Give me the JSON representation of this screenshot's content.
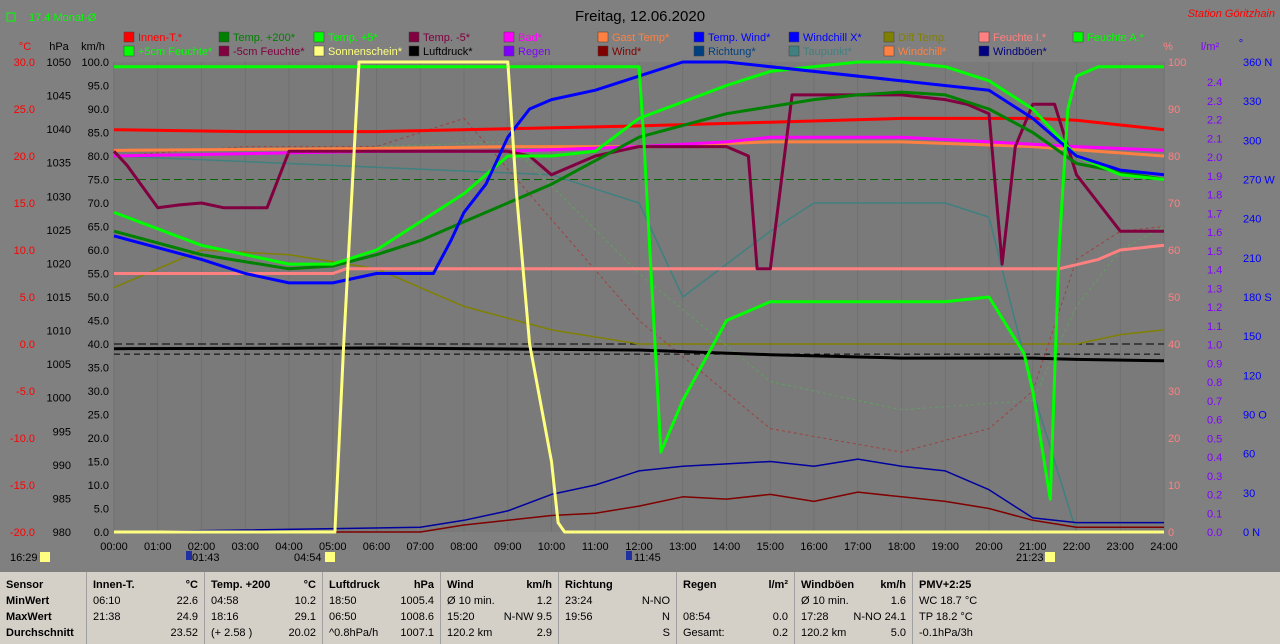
{
  "header": {
    "title": "Freitag, 12.06.2020",
    "station": "Station Göritzhain",
    "monthly": "17.4 Monat-Ø"
  },
  "legend_row1": [
    "Innen-T.*",
    "Temp. +200*",
    "Temp. +5*",
    "Temp. -5*",
    "Bad*",
    "Gast Temp*",
    "Temp. Wind*",
    "Windchill X*",
    "Diff Temp.",
    "Feuchte I.*",
    "Feuchte A.*"
  ],
  "legend_row2": [
    "+5cm Feuchte*",
    "-5cm Feuchte*",
    "Sonnenschein*",
    "Luftdruck*",
    "Regen",
    "Wind*",
    "Richtung*",
    "Taupunkt*",
    "Windchill*",
    "Windböen*"
  ],
  "axes": {
    "temp_unit": "°C",
    "pressure_unit": "hPa",
    "speed_unit": "km/h",
    "humidity_unit": "%",
    "rain_unit": "l/m²",
    "direction_unit": "°",
    "temp_ticks": [
      "30.0",
      "25.0",
      "20.0",
      "15.0",
      "10.0",
      "5.0",
      "0.0",
      "-5.0",
      "-10.0",
      "-15.0",
      "-20.0"
    ],
    "pressure_ticks": [
      "1050",
      "1045",
      "1040",
      "1035",
      "1030",
      "1025",
      "1020",
      "1015",
      "1010",
      "1005",
      "1000",
      "995",
      "990",
      "985",
      "980"
    ],
    "speed_ticks": [
      "100.0",
      "95.0",
      "90.0",
      "85.0",
      "80.0",
      "75.0",
      "70.0",
      "65.0",
      "60.0",
      "55.0",
      "50.0",
      "45.0",
      "40.0",
      "35.0",
      "30.0",
      "25.0",
      "20.0",
      "15.0",
      "10.0",
      "5.0",
      "0.0"
    ],
    "humidity_ticks": [
      "100",
      "90",
      "80",
      "70",
      "60",
      "50",
      "40",
      "30",
      "20",
      "10",
      "0"
    ],
    "rain_ticks": [
      "2.4",
      "2.3",
      "2.2",
      "2.1",
      "2.0",
      "1.9",
      "1.8",
      "1.7",
      "1.6",
      "1.5",
      "1.4",
      "1.3",
      "1.2",
      "1.1",
      "1.0",
      "0.9",
      "0.8",
      "0.7",
      "0.6",
      "0.5",
      "0.4",
      "0.3",
      "0.2",
      "0.1",
      "0.0"
    ],
    "direction_ticks": [
      "360 N",
      "330",
      "300",
      "270 W",
      "240",
      "210",
      "180 S",
      "150",
      "120",
      "90 O",
      "60",
      "30",
      "0 N"
    ],
    "time_ticks": [
      "00:00",
      "01:00",
      "02:00",
      "03:00",
      "04:00",
      "05:00",
      "06:00",
      "07:00",
      "08:00",
      "09:00",
      "10:00",
      "11:00",
      "12:00",
      "13:00",
      "14:00",
      "15:00",
      "16:00",
      "17:00",
      "18:00",
      "19:00",
      "20:00",
      "21:00",
      "22:00",
      "23:00",
      "24:00"
    ],
    "markers": [
      "16:29",
      "01:43",
      "04:54",
      "11:45",
      "21:23"
    ]
  },
  "chart_data": {
    "type": "line",
    "title": "Freitag, 12.06.2020",
    "x_unit": "hour",
    "xlim": [
      0,
      24
    ],
    "y_left": {
      "unit": "°C",
      "ylim": [
        -20,
        30
      ]
    },
    "y_right": {
      "unit": "%",
      "ylim": [
        0,
        100
      ]
    },
    "series": [
      {
        "name": "Innen-T.*",
        "axis": "temp",
        "color": "#ff0000",
        "x": [
          0,
          3,
          6,
          9,
          12,
          15,
          18,
          21,
          22,
          24
        ],
        "y": [
          22.8,
          22.6,
          22.6,
          22.9,
          23.2,
          23.6,
          24.0,
          24.0,
          23.8,
          22.8
        ]
      },
      {
        "name": "Temp. +200*",
        "axis": "temp",
        "color": "#008000",
        "x": [
          0,
          2,
          4,
          5,
          6,
          7,
          8,
          9,
          10,
          11,
          12,
          14,
          16,
          17,
          18,
          19,
          20,
          21,
          22,
          23,
          24
        ],
        "y": [
          12.0,
          9.5,
          8.0,
          8.3,
          9.5,
          11.0,
          13.0,
          15.0,
          17.0,
          19.5,
          22.0,
          24.5,
          26.0,
          26.5,
          26.8,
          26.5,
          25.0,
          22.5,
          19.2,
          18.3,
          17.5
        ]
      },
      {
        "name": "Temp. +5*",
        "axis": "temp",
        "color": "#00ff00",
        "x": [
          0,
          2,
          4,
          5,
          6,
          7,
          8,
          9,
          10,
          11,
          12,
          14,
          15,
          17,
          18,
          19,
          20,
          21,
          22,
          23,
          24
        ],
        "y": [
          14.0,
          10.5,
          8.5,
          8.5,
          10.0,
          13.0,
          16.0,
          20.0,
          20.0,
          20.5,
          24.0,
          27.5,
          29.0,
          30.0,
          30.0,
          29.5,
          28.0,
          25.0,
          20.0,
          18.0,
          17.5
        ]
      },
      {
        "name": "Temp. Wind*",
        "axis": "temp",
        "color": "#0000ff",
        "x": [
          0,
          2,
          3,
          4,
          5,
          6,
          7,
          7.3,
          7.7,
          8,
          8.5,
          9,
          9.5,
          10,
          11,
          12,
          13,
          14,
          20,
          21,
          22,
          23,
          24
        ],
        "y": [
          11.5,
          9.0,
          7.5,
          6.5,
          6.5,
          7.5,
          7.5,
          7.5,
          11.0,
          14.0,
          17.0,
          22.0,
          25.0,
          26.0,
          27.0,
          28.5,
          30.0,
          31.0,
          27.0,
          24.0,
          20.0,
          18.5,
          18.0
        ]
      },
      {
        "name": "Temp. -5*",
        "axis": "temp",
        "color": "#800040",
        "x": [
          0,
          0.3,
          1,
          1.5,
          2,
          2.5,
          3,
          3.5,
          4,
          5,
          6,
          7,
          8,
          9,
          9.5,
          10,
          11,
          12,
          14,
          14.5,
          14.7,
          15,
          15.5,
          18,
          19,
          19.5,
          20,
          20.3,
          20.6,
          21,
          21.5,
          22,
          22.5,
          23,
          24
        ],
        "y": [
          20.5,
          19.0,
          14.5,
          14.8,
          15.0,
          14.5,
          14.5,
          14.5,
          20.5,
          20.5,
          20.5,
          20.5,
          20.5,
          20.5,
          20.0,
          18.0,
          20.0,
          21.0,
          21.0,
          20.0,
          8.0,
          8.0,
          26.5,
          26.5,
          26.0,
          25.5,
          24.5,
          8.5,
          21.0,
          25.5,
          25.5,
          18.0,
          15.0,
          12.0,
          12.0
        ]
      },
      {
        "name": "Bad*",
        "axis": "temp",
        "color": "#ff00ff",
        "x": [
          0,
          6,
          9,
          12,
          14,
          15,
          16,
          18,
          20,
          22,
          24
        ],
        "y": [
          20.0,
          20.5,
          20.5,
          21.0,
          21.5,
          22.0,
          22.0,
          22.0,
          21.5,
          21.0,
          20.6
        ]
      },
      {
        "name": "Gast Temp*",
        "axis": "temp",
        "color": "#ff8040",
        "x": [
          0,
          6,
          9,
          12,
          15,
          18,
          21,
          24
        ],
        "y": [
          20.6,
          20.8,
          21.0,
          21.0,
          21.5,
          21.5,
          21.0,
          20.0
        ]
      },
      {
        "name": "Feuchte I.*",
        "axis": "hum",
        "color": "#ff8080",
        "x": [
          0,
          5,
          5.3,
          12,
          16,
          17,
          18,
          19,
          20,
          21,
          21.6,
          22.5,
          23,
          24
        ],
        "y": [
          55,
          55,
          56,
          56,
          56,
          56,
          56,
          56,
          56,
          56,
          56,
          58,
          60,
          61
        ]
      },
      {
        "name": "Feuchte A.*",
        "axis": "hum",
        "color": "#00ff00",
        "x": [
          0,
          12,
          12.1,
          12.5,
          13,
          14,
          15,
          16,
          18,
          19,
          20,
          20.8,
          21,
          21.4,
          21.6,
          21.8,
          22,
          22.5,
          23,
          24
        ],
        "y": [
          99,
          99,
          85,
          17,
          28,
          45,
          49,
          49,
          49,
          49,
          50,
          38,
          30,
          7,
          60,
          90,
          97,
          99,
          99,
          99
        ]
      },
      {
        "name": "Sonnenschein*",
        "axis": "hum",
        "color": "#ffff80",
        "x": [
          0,
          5.05,
          5.25,
          5.6,
          9.0,
          9.2,
          9.5,
          10,
          10.15,
          10.3,
          24
        ],
        "y": [
          0,
          0,
          40,
          100,
          100,
          72,
          40,
          15,
          2,
          0,
          0
        ]
      },
      {
        "name": "Luftdruck*",
        "axis": "pres",
        "color": "#000000",
        "x": [
          0,
          6,
          12,
          15,
          18,
          21,
          22,
          24
        ],
        "y": [
          1007.3,
          1007.4,
          1007.1,
          1006.4,
          1005.9,
          1005.9,
          1005.7,
          1005.5
        ]
      },
      {
        "name": "Wind*",
        "axis": "speed",
        "color": "#800000",
        "x": [
          0,
          7,
          8,
          9,
          10,
          11,
          12,
          13,
          14,
          15,
          16,
          17,
          18,
          19,
          20,
          21,
          22,
          23,
          24
        ],
        "y": [
          0,
          0,
          1.5,
          2.5,
          3.5,
          4.0,
          5.5,
          7.5,
          7.0,
          8.0,
          6.5,
          8.5,
          7.5,
          6.5,
          5.0,
          2.5,
          1.0,
          1.0,
          1.0
        ]
      },
      {
        "name": "Windböen*",
        "axis": "speed",
        "color": "#0000a0",
        "x": [
          0,
          7,
          8,
          9,
          10,
          11,
          12,
          13,
          14,
          15,
          16,
          17,
          18,
          19,
          20,
          21,
          22,
          23,
          24
        ],
        "y": [
          0,
          1,
          2.5,
          4.5,
          8,
          10,
          13,
          14,
          14.5,
          15,
          14,
          15.5,
          14,
          13,
          9,
          3,
          2,
          2,
          2
        ]
      },
      {
        "name": "+5cm Feuchte*",
        "axis": "hum",
        "color": "#60a060",
        "dashed": true,
        "x": [
          0,
          3,
          6,
          9,
          12,
          15,
          18,
          21,
          22,
          23,
          24
        ],
        "y": [
          80,
          82,
          82,
          83,
          55,
          32,
          26,
          28,
          48,
          60,
          65
        ]
      },
      {
        "name": "-5cm Feuchte*",
        "axis": "hum",
        "color": "#a04040",
        "dashed": true,
        "x": [
          0,
          3,
          6,
          8,
          12,
          15,
          18,
          20,
          21,
          22,
          23,
          24
        ],
        "y": [
          80,
          82,
          82,
          88,
          45,
          22,
          17,
          22,
          30,
          58,
          64,
          65
        ]
      },
      {
        "name": "Taupunkt*",
        "axis": "hum",
        "color": "#408080",
        "x": [
          0,
          10,
          12,
          13,
          14,
          15,
          16,
          18,
          19,
          20,
          21,
          22,
          23,
          24
        ],
        "y": [
          80,
          76,
          70,
          50,
          57,
          64,
          70,
          70,
          70,
          67,
          30,
          0,
          0,
          0
        ]
      },
      {
        "name": "Diff Temp.",
        "axis": "hum",
        "color": "#808000",
        "x": [
          0,
          2,
          4,
          6,
          8,
          10,
          12,
          16,
          18,
          20,
          21,
          22,
          23,
          24
        ],
        "y": [
          52,
          60,
          59,
          56,
          48,
          43,
          40,
          40,
          40,
          40,
          40,
          40,
          42,
          43
        ]
      }
    ]
  },
  "table": {
    "sensor": [
      "Sensor",
      "MinWert",
      "MaxWert",
      "Durchschnitt"
    ],
    "innen": {
      "head": [
        "Innen-T.",
        "°C"
      ],
      "min": [
        "06:10",
        "22.6"
      ],
      "max": [
        "21:38",
        "24.9"
      ],
      "avg": [
        "",
        "23.52"
      ]
    },
    "temp200": {
      "head": [
        "Temp. +200",
        "°C"
      ],
      "min": [
        "04:58",
        "10.2"
      ],
      "max": [
        "18:16",
        "29.1"
      ],
      "avg": [
        "(+ 2.58 )",
        "20.02"
      ]
    },
    "druck": {
      "head": [
        "Luftdruck",
        "hPa"
      ],
      "min": [
        "18:50",
        "1005.4"
      ],
      "max": [
        "06:50",
        "1008.6"
      ],
      "avg": [
        "^0.8hPa/h",
        "1007.1"
      ]
    },
    "wind": {
      "head": [
        "Wind",
        "km/h"
      ],
      "min": [
        "Ø 10 min.",
        "1.2"
      ],
      "max": [
        "15:20",
        "N-NW 9.5"
      ],
      "avg": [
        "120.2 km",
        "2.9"
      ]
    },
    "richtung": {
      "head": [
        "Richtung",
        ""
      ],
      "min": [
        "23:24",
        "N-NO"
      ],
      "max": [
        "19:56",
        "N"
      ],
      "avg": [
        "",
        "S"
      ]
    },
    "regen": {
      "head": [
        "Regen",
        "l/m²"
      ],
      "min": [
        "",
        ""
      ],
      "max": [
        "08:54",
        "0.0"
      ],
      "avg": [
        "Gesamt:",
        "0.2"
      ]
    },
    "boeen": {
      "head": [
        "Windböen",
        "km/h"
      ],
      "min": [
        "Ø 10 min.",
        "1.6"
      ],
      "max": [
        "17:28",
        "N-NO 24.1"
      ],
      "avg": [
        "120.2 km",
        "5.0"
      ]
    },
    "pmv": {
      "head": [
        "PMV+2:25",
        ""
      ],
      "min": [
        "WC 18.7 °C",
        ""
      ],
      "max": [
        "TP 18.2 °C",
        ""
      ],
      "avg": [
        "-0.1hPa/3h",
        ""
      ]
    }
  }
}
